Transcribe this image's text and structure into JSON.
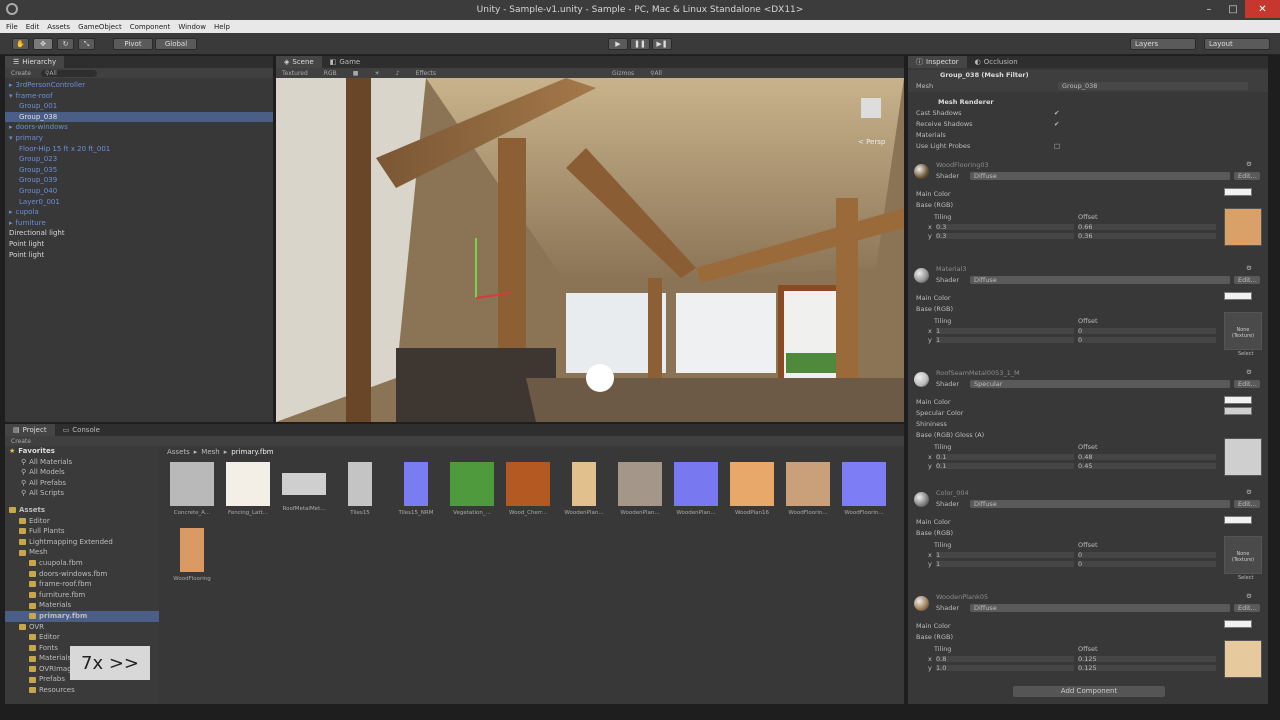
{
  "window": {
    "title": "Unity - Sample-v1.unity - Sample - PC, Mac & Linux Standalone <DX11>",
    "controls": [
      "–",
      "□",
      "✕"
    ]
  },
  "menu": [
    "File",
    "Edit",
    "Assets",
    "GameObject",
    "Component",
    "Window",
    "Help"
  ],
  "toolbar": {
    "pivot": "Pivot",
    "global": "Global",
    "layers": "Layers",
    "layout": "Layout",
    "play": "▶",
    "pause": "❚❚",
    "step": "▶❚"
  },
  "hierarchy": {
    "tab": "Hierarchy",
    "create": "Create",
    "search": "⚲All",
    "items": [
      {
        "label": "3rdPersonController",
        "indent": 0,
        "color": "blue",
        "arrow": "▸"
      },
      {
        "label": "frame-roof",
        "indent": 0,
        "color": "blue",
        "arrow": "▾"
      },
      {
        "label": "Group_001",
        "indent": 1,
        "color": "blue",
        "arrow": ""
      },
      {
        "label": "Group_038",
        "indent": 1,
        "color": "sel",
        "arrow": ""
      },
      {
        "label": "doors-windows",
        "indent": 0,
        "color": "blue",
        "arrow": "▸"
      },
      {
        "label": "primary",
        "indent": 0,
        "color": "blue",
        "arrow": "▾"
      },
      {
        "label": "Floor-Hip 15 ft x 20 ft_001",
        "indent": 1,
        "color": "blue",
        "arrow": ""
      },
      {
        "label": "Group_023",
        "indent": 1,
        "color": "blue",
        "arrow": ""
      },
      {
        "label": "Group_035",
        "indent": 1,
        "color": "blue",
        "arrow": ""
      },
      {
        "label": "Group_039",
        "indent": 1,
        "color": "blue",
        "arrow": ""
      },
      {
        "label": "Group_040",
        "indent": 1,
        "color": "blue",
        "arrow": ""
      },
      {
        "label": "Layer0_001",
        "indent": 1,
        "color": "blue",
        "arrow": ""
      },
      {
        "label": "cupola",
        "indent": 0,
        "color": "blue",
        "arrow": "▸"
      },
      {
        "label": "furniture",
        "indent": 0,
        "color": "blue",
        "arrow": "▸"
      },
      {
        "label": "Directional light",
        "indent": 0,
        "color": "white",
        "arrow": ""
      },
      {
        "label": "Point light",
        "indent": 0,
        "color": "white",
        "arrow": ""
      },
      {
        "label": "Point light",
        "indent": 0,
        "color": "white",
        "arrow": ""
      }
    ]
  },
  "scene": {
    "tab_scene": "Scene",
    "tab_game": "Game",
    "shading": "Textured",
    "rgb": "RGB",
    "effects": "Effects",
    "gizmos": "Gizmos",
    "search": "⚲All",
    "persp": "< Persp"
  },
  "project": {
    "tab_project": "Project",
    "tab_console": "Console",
    "create": "Create",
    "breadcrumb": [
      "Assets",
      "Mesh",
      "primary.fbm"
    ],
    "favorites": {
      "label": "Favorites",
      "items": [
        "All Materials",
        "All Models",
        "All Prefabs",
        "All Scripts"
      ]
    },
    "assets_tree": [
      {
        "label": "Assets",
        "indent": 0,
        "bold": true,
        "sel": false
      },
      {
        "label": "Editor",
        "indent": 1,
        "bold": false,
        "sel": false
      },
      {
        "label": "Full Plants",
        "indent": 1,
        "bold": false,
        "sel": false
      },
      {
        "label": "Lightmapping Extended",
        "indent": 1,
        "bold": false,
        "sel": false
      },
      {
        "label": "Mesh",
        "indent": 1,
        "bold": false,
        "sel": false
      },
      {
        "label": "cuupola.fbm",
        "indent": 2,
        "bold": false,
        "sel": false
      },
      {
        "label": "doors-windows.fbm",
        "indent": 2,
        "bold": false,
        "sel": false
      },
      {
        "label": "frame-roof.fbm",
        "indent": 2,
        "bold": false,
        "sel": false
      },
      {
        "label": "furniture.fbm",
        "indent": 2,
        "bold": false,
        "sel": false
      },
      {
        "label": "Materials",
        "indent": 2,
        "bold": false,
        "sel": false
      },
      {
        "label": "primary.fbm",
        "indent": 2,
        "bold": true,
        "sel": true
      },
      {
        "label": "OVR",
        "indent": 1,
        "bold": false,
        "sel": false
      },
      {
        "label": "Editor",
        "indent": 2,
        "bold": false,
        "sel": false
      },
      {
        "label": "Fonts",
        "indent": 2,
        "bold": false,
        "sel": false
      },
      {
        "label": "Materials",
        "indent": 2,
        "bold": false,
        "sel": false
      },
      {
        "label": "OVRImage",
        "indent": 2,
        "bold": false,
        "sel": false
      },
      {
        "label": "Prefabs",
        "indent": 2,
        "bold": false,
        "sel": false
      },
      {
        "label": "Resources",
        "indent": 2,
        "bold": false,
        "sel": false
      }
    ],
    "assets": [
      {
        "label": "Concrete_A...",
        "color": "#b9b9b9"
      },
      {
        "label": "Fencing_Latt...",
        "color": "#f4efe6"
      },
      {
        "label": "RoofMetalMet...",
        "color": "#cfcfcf"
      },
      {
        "label": "Tiles15",
        "color": "#c4c4c4"
      },
      {
        "label": "Tiles15_NRM",
        "color": "#7a7cf4"
      },
      {
        "label": "Vegetation_...",
        "color": "#4f9a3c"
      },
      {
        "label": "Wood_Cherr...",
        "color": "#b25a22"
      },
      {
        "label": "WoodenPlan...",
        "color": "#e2c08e"
      },
      {
        "label": "WoodenPlan...",
        "color": "#a4978a"
      },
      {
        "label": "WoodenPlan...",
        "color": "#7878f0"
      },
      {
        "label": "WoodPlan16",
        "color": "#e7a86a"
      },
      {
        "label": "WoodFloorin...",
        "color": "#caa07a"
      },
      {
        "label": "WoodFloorin...",
        "color": "#7d7df5"
      },
      {
        "label": "WoodFlooring",
        "color": "#d99a66"
      }
    ],
    "speed_overlay": "7x >>"
  },
  "inspector": {
    "tab_inspector": "Inspector",
    "tab_occlusion": "Occlusion",
    "mesh_filter": {
      "title": "Group_038 (Mesh Filter)",
      "mesh_label": "Mesh",
      "mesh_value": "Group_038"
    },
    "mesh_renderer": {
      "title": "Mesh Renderer",
      "rows": [
        {
          "label": "Cast Shadows",
          "value": "✔"
        },
        {
          "label": "Receive Shadows",
          "value": "✔"
        },
        {
          "label": "Materials",
          "value": ""
        },
        {
          "label": "Use Light Probes",
          "value": "□"
        }
      ]
    },
    "materials": [
      {
        "name": "WoodFlooring03",
        "shader": "Diffuse",
        "color": "#6b5436",
        "props": [
          "Main Color",
          "Base (RGB)"
        ],
        "tiling": [
          "0.3",
          "0.3"
        ],
        "offset": [
          "0.66",
          "0.36"
        ],
        "tex": "#d9a068",
        "slot": ""
      },
      {
        "name": "Material3",
        "shader": "Diffuse",
        "color": "#8f8f8f",
        "props": [
          "Main Color",
          "Base (RGB)"
        ],
        "tiling": [
          "1",
          "1"
        ],
        "offset": [
          "0",
          "0"
        ],
        "tex": "",
        "slot": "None (Texture)"
      },
      {
        "name": "RoofSeamMetal0053_1_M",
        "shader": "Specular",
        "color": "#b8b8b8",
        "props": [
          "Main Color",
          "Specular Color",
          "Shininess",
          "Base (RGB) Gloss (A)"
        ],
        "tiling": [
          "0.1",
          "0.1"
        ],
        "offset": [
          "0.48",
          "0.45"
        ],
        "tex": "#cfcfcf",
        "slot": ""
      },
      {
        "name": "Color_004",
        "shader": "Diffuse",
        "color": "#7c7c7c",
        "props": [
          "Main Color",
          "Base (RGB)"
        ],
        "tiling": [
          "1",
          "1"
        ],
        "offset": [
          "0",
          "0"
        ],
        "tex": "",
        "slot": "None (Texture)"
      },
      {
        "name": "WoodenPlank05",
        "shader": "Diffuse",
        "color": "#9a7a50",
        "props": [
          "Main Color",
          "Base (RGB)"
        ],
        "tiling": [
          "0.8",
          "1.0"
        ],
        "offset": [
          "0.125",
          "0.125"
        ],
        "tex": "#e6c99c",
        "slot": ""
      }
    ],
    "tiling_label": "Tiling",
    "offset_label": "Offset",
    "edit_label": "Edit...",
    "select_label": "Select",
    "axis": [
      "x",
      "y"
    ],
    "add_component": "Add Component"
  }
}
